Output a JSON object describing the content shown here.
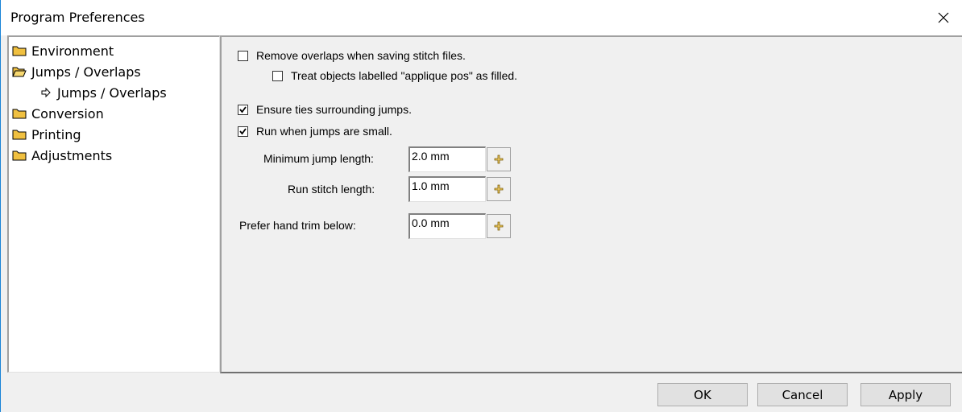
{
  "window": {
    "title": "Program Preferences"
  },
  "tree": {
    "items": [
      {
        "label": "Environment"
      },
      {
        "label": "Jumps / Overlaps"
      },
      {
        "label": "Jumps / Overlaps"
      },
      {
        "label": "Conversion"
      },
      {
        "label": "Printing"
      },
      {
        "label": "Adjustments"
      }
    ]
  },
  "options": {
    "remove_overlaps": {
      "label": "Remove overlaps when saving stitch files.",
      "checked": false
    },
    "treat_applique": {
      "label": "Treat objects labelled \"applique pos\" as filled.",
      "checked": false
    },
    "ensure_ties": {
      "label": "Ensure ties surrounding jumps.",
      "checked": true
    },
    "run_small": {
      "label": "Run when jumps are small.",
      "checked": true
    }
  },
  "fields": {
    "min_jump": {
      "label": "Minimum jump length:",
      "value": "2.0 mm"
    },
    "run_stitch": {
      "label": "Run stitch length:",
      "value": "1.0 mm"
    },
    "hand_trim": {
      "label": "Prefer hand trim below:",
      "value": "0.0 mm"
    }
  },
  "buttons": {
    "ok": "OK",
    "cancel": "Cancel",
    "apply": "Apply"
  },
  "colors": {
    "accent": "#1883d7",
    "folder": "#f0c040"
  }
}
